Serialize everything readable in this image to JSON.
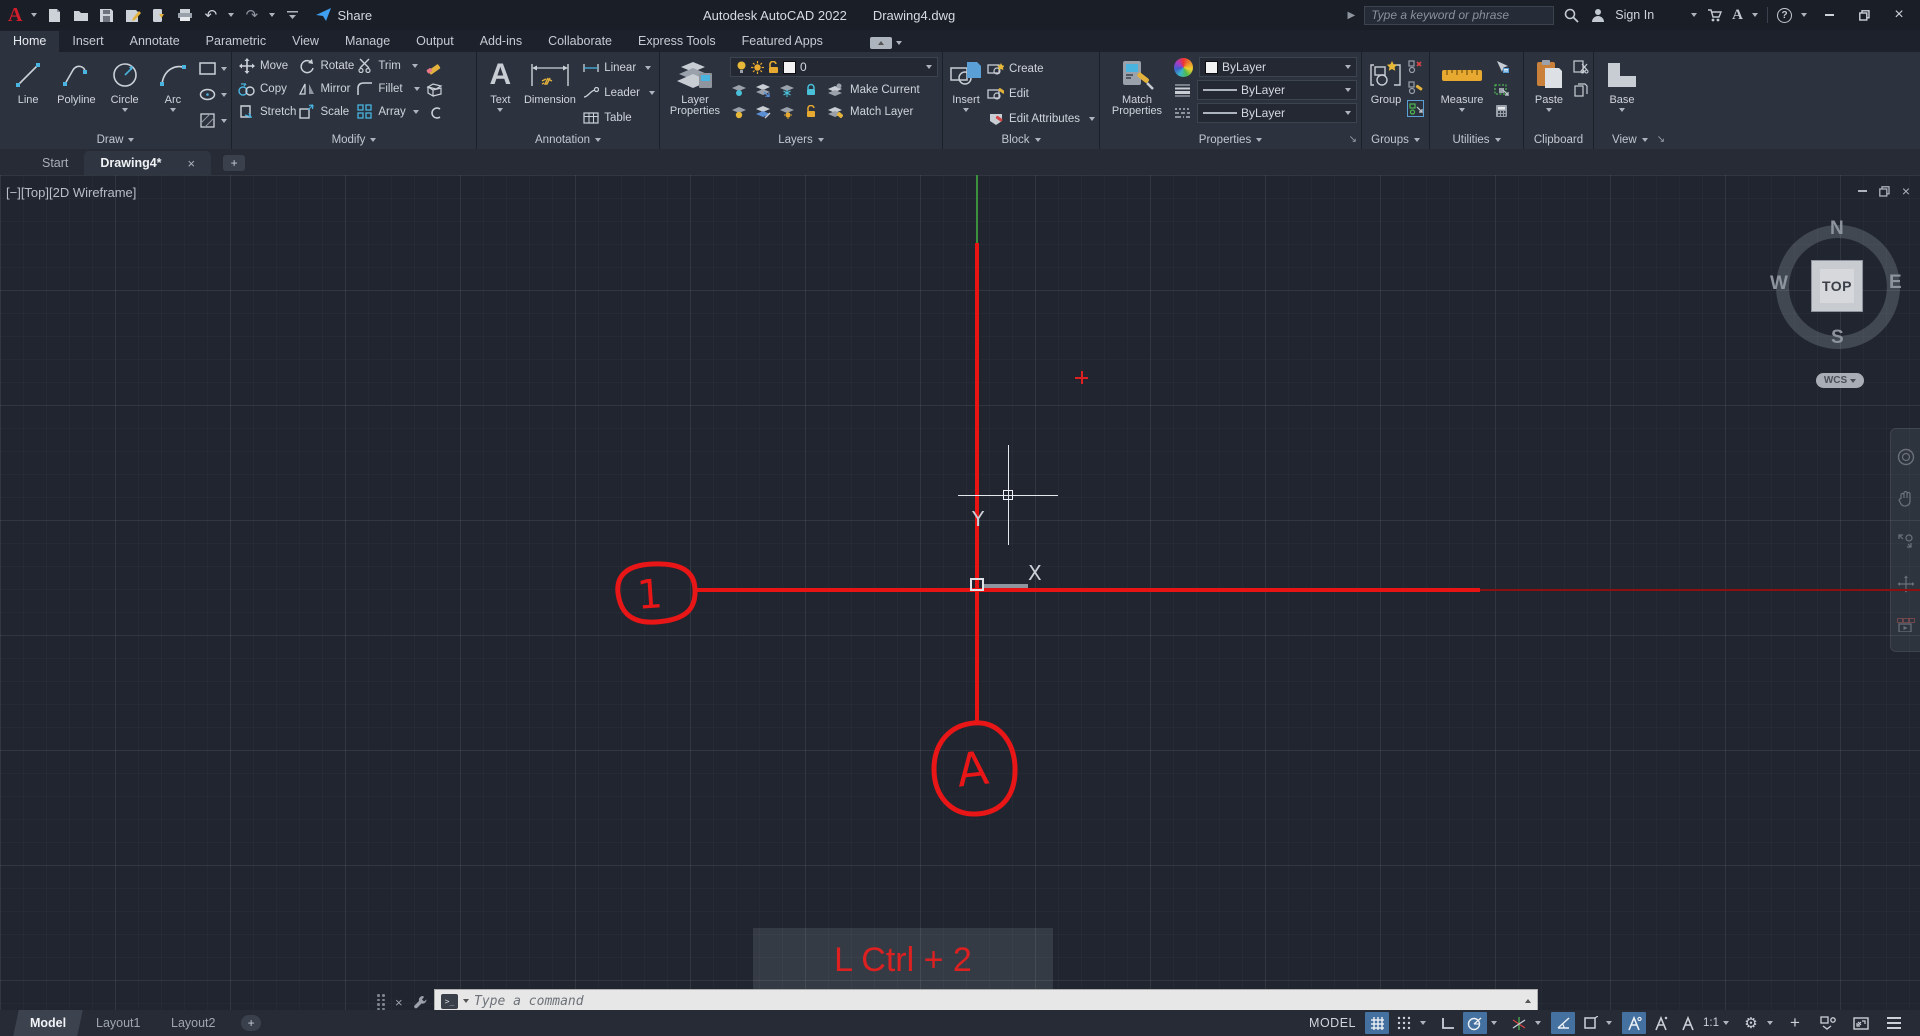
{
  "titlebar": {
    "app_title": "Autodesk AutoCAD 2022",
    "doc_title": "Drawing4.dwg",
    "share_label": "Share",
    "search_placeholder": "Type a keyword or phrase",
    "sign_in_label": "Sign In",
    "undo_glyph": "↶",
    "redo_glyph": "↷",
    "help_glyph": "?",
    "close_glyph": "×"
  },
  "ribbon": {
    "tabs": [
      "Home",
      "Insert",
      "Annotate",
      "Parametric",
      "View",
      "Manage",
      "Output",
      "Add-ins",
      "Collaborate",
      "Express Tools",
      "Featured Apps"
    ],
    "active_tab": "Home"
  },
  "panels": {
    "draw": {
      "label": "Draw",
      "buttons": [
        "Line",
        "Polyline",
        "Circle",
        "Arc"
      ]
    },
    "modify": {
      "label": "Modify",
      "col1": [
        "Move",
        "Copy",
        "Stretch"
      ],
      "col2": [
        "Rotate",
        "Mirror",
        "Scale"
      ],
      "col3": [
        "Trim",
        "Fillet",
        "Array"
      ]
    },
    "annotation": {
      "label": "Annotation",
      "text": "Text",
      "dimension": "Dimension",
      "small": [
        "Linear",
        "Leader",
        "Table"
      ]
    },
    "layers": {
      "label": "Layers",
      "big1": "Layer",
      "big2": "Properties",
      "current_layer": "0",
      "make_current": "Make Current",
      "match_layer": "Match Layer"
    },
    "block": {
      "label": "Block",
      "big": "Insert",
      "items": [
        "Create",
        "Edit",
        "Edit Attributes"
      ]
    },
    "properties": {
      "label": "Properties",
      "big1": "Match",
      "big2": "Properties",
      "color_value": "ByLayer",
      "lineweight_value": "ByLayer",
      "linetype_value": "ByLayer"
    },
    "groups": {
      "label": "Groups",
      "big": "Group"
    },
    "utilities": {
      "label": "Utilities",
      "big": "Measure"
    },
    "clipboard": {
      "label": "Clipboard",
      "big": "Paste"
    },
    "view": {
      "label": "View",
      "big": "Base"
    }
  },
  "file_tabs": {
    "start": "Start",
    "active_doc": "Drawing4*",
    "close_glyph": "×",
    "add_glyph": "+"
  },
  "canvas": {
    "viewport_label": "[−][Top][2D Wireframe]",
    "compass": {
      "n": "N",
      "e": "E",
      "s": "S",
      "w": "W",
      "top": "TOP",
      "wcs": "WCS"
    },
    "ucs_x": "X",
    "ucs_y": "Y",
    "bubble_1": "1",
    "bubble_a": "A",
    "overlay_text": "L Ctrl + 2",
    "line_color": "#e81414"
  },
  "command": {
    "placeholder": "Type a command",
    "prompt_glyph": ">_"
  },
  "statusbar": {
    "model_tab": "Model",
    "layout1_tab": "Layout1",
    "layout2_tab": "Layout2",
    "add_glyph": "+",
    "model_label": "MODEL",
    "scale": "1:1",
    "gear_glyph": "⚙",
    "plus_glyph": "+"
  }
}
